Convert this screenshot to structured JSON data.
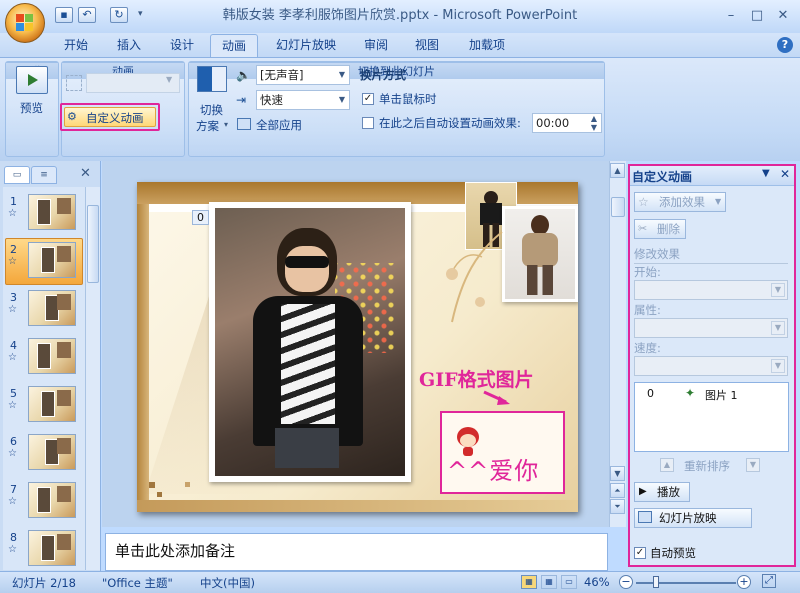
{
  "window": {
    "title": "韩版女装 李孝利服饰图片欣赏.pptx - Microsoft PowerPoint",
    "minimize": "–",
    "maximize": "□",
    "close": "✕"
  },
  "tabs": [
    "开始",
    "插入",
    "设计",
    "动画",
    "幻灯片放映",
    "审阅",
    "视图",
    "加载项"
  ],
  "ribbon": {
    "preview_group": {
      "button": "预览",
      "label": "预览"
    },
    "animation_group": {
      "effect_combo": "",
      "custom_animation": "自定义动画",
      "label": "动画"
    },
    "transition_group": {
      "switch_scheme": "切换",
      "switch_scheme_2": "方案",
      "sound_combo": "[无声音]",
      "speed_combo": "快速",
      "apply_all": "全部应用",
      "advance_title": "换片方式",
      "on_click": "单击鼠标时",
      "on_click_checked": true,
      "auto_after": "在此之后自动设置动画效果:",
      "auto_after_checked": false,
      "time_value": "00:00",
      "label": "切换到此幻灯片"
    }
  },
  "slides_panel": {
    "slides": [
      {
        "num": "1",
        "star": "☆"
      },
      {
        "num": "2",
        "star": "☆"
      },
      {
        "num": "3",
        "star": "☆"
      },
      {
        "num": "4",
        "star": "☆"
      },
      {
        "num": "5",
        "star": "☆"
      },
      {
        "num": "6",
        "star": "☆"
      },
      {
        "num": "7",
        "star": "☆"
      },
      {
        "num": "8",
        "star": "☆"
      }
    ],
    "selected": "2"
  },
  "slide": {
    "anim_tag": "0",
    "gif_label": "GIF格式图片",
    "gif_text": "^^爱你"
  },
  "notes": {
    "placeholder": "单击此处添加备注"
  },
  "task_pane": {
    "title": "自定义动画",
    "add_effect": "添加效果",
    "remove": "删除",
    "modify_title": "修改效果",
    "start_label": "开始:",
    "property_label": "属性:",
    "speed_label": "速度:",
    "list_item_index": "0",
    "list_item_name": "图片 1",
    "reorder": "重新排序",
    "play": "播放",
    "slideshow": "幻灯片放映",
    "auto_preview": "自动预览",
    "auto_preview_checked": true
  },
  "status": {
    "slide": "幻灯片 2/18",
    "theme": "\"Office 主题\"",
    "language": "中文(中国)",
    "zoom": "46%",
    "zoom_level": 0.46
  },
  "colors": {
    "highlight": "#e0269a",
    "ribbon": "#dbe8fa"
  }
}
